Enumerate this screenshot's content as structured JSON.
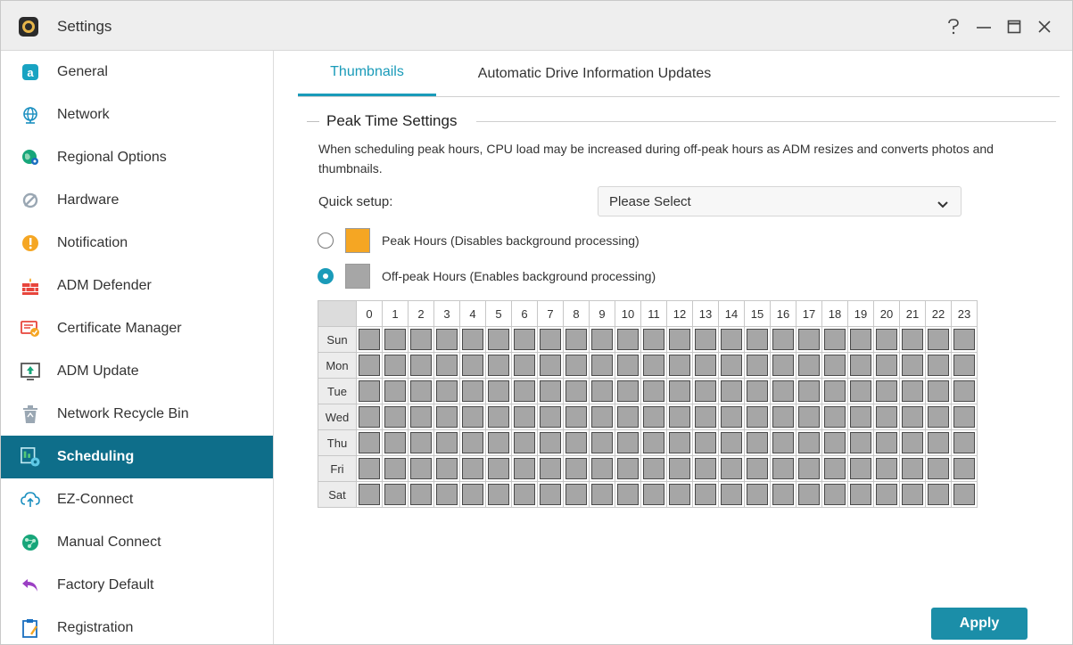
{
  "window": {
    "title": "Settings",
    "controls": [
      "help-icon",
      "minimize-icon",
      "maximize-icon",
      "close-icon"
    ]
  },
  "sidebar": {
    "items": [
      {
        "label": "General",
        "icon": "general-icon"
      },
      {
        "label": "Network",
        "icon": "network-globe-icon"
      },
      {
        "label": "Regional Options",
        "icon": "regional-globe-icon"
      },
      {
        "label": "Hardware",
        "icon": "hardware-icon"
      },
      {
        "label": "Notification",
        "icon": "notification-icon"
      },
      {
        "label": "ADM Defender",
        "icon": "firewall-icon"
      },
      {
        "label": "Certificate Manager",
        "icon": "certificate-icon"
      },
      {
        "label": "ADM Update",
        "icon": "update-icon"
      },
      {
        "label": "Network Recycle Bin",
        "icon": "recycle-bin-icon"
      },
      {
        "label": "Scheduling",
        "icon": "scheduling-icon",
        "active": true
      },
      {
        "label": "EZ-Connect",
        "icon": "cloud-icon"
      },
      {
        "label": "Manual Connect",
        "icon": "manual-connect-icon"
      },
      {
        "label": "Factory Default",
        "icon": "undo-arrow-icon"
      },
      {
        "label": "Registration",
        "icon": "registration-icon"
      }
    ]
  },
  "tabs": [
    {
      "label": "Thumbnails",
      "active": true
    },
    {
      "label": "Automatic Drive Information Updates",
      "active": false
    }
  ],
  "section": {
    "title": "Peak Time Settings",
    "description": "When scheduling peak hours, CPU load may be increased during off-peak hours as ADM resizes and converts photos and thumbnails."
  },
  "quick_setup": {
    "label": "Quick setup:",
    "value": "Please Select"
  },
  "options": {
    "peak": {
      "label": "Peak Hours (Disables background processing)",
      "selected": false,
      "color": "#f5a623"
    },
    "offpeak": {
      "label": "Off-peak Hours (Enables background processing)",
      "selected": true,
      "color": "#a6a6a6"
    }
  },
  "schedule": {
    "hours": [
      "0",
      "1",
      "2",
      "3",
      "4",
      "5",
      "6",
      "7",
      "8",
      "9",
      "10",
      "11",
      "12",
      "13",
      "14",
      "15",
      "16",
      "17",
      "18",
      "19",
      "20",
      "21",
      "22",
      "23"
    ],
    "days": [
      "Sun",
      "Mon",
      "Tue",
      "Wed",
      "Thu",
      "Fri",
      "Sat"
    ],
    "state": "off-peak"
  },
  "apply_label": "Apply",
  "colors": {
    "accent": "#1a9bb9",
    "sidebar_active": "#0e6e8a",
    "apply": "#1b8ea8"
  }
}
